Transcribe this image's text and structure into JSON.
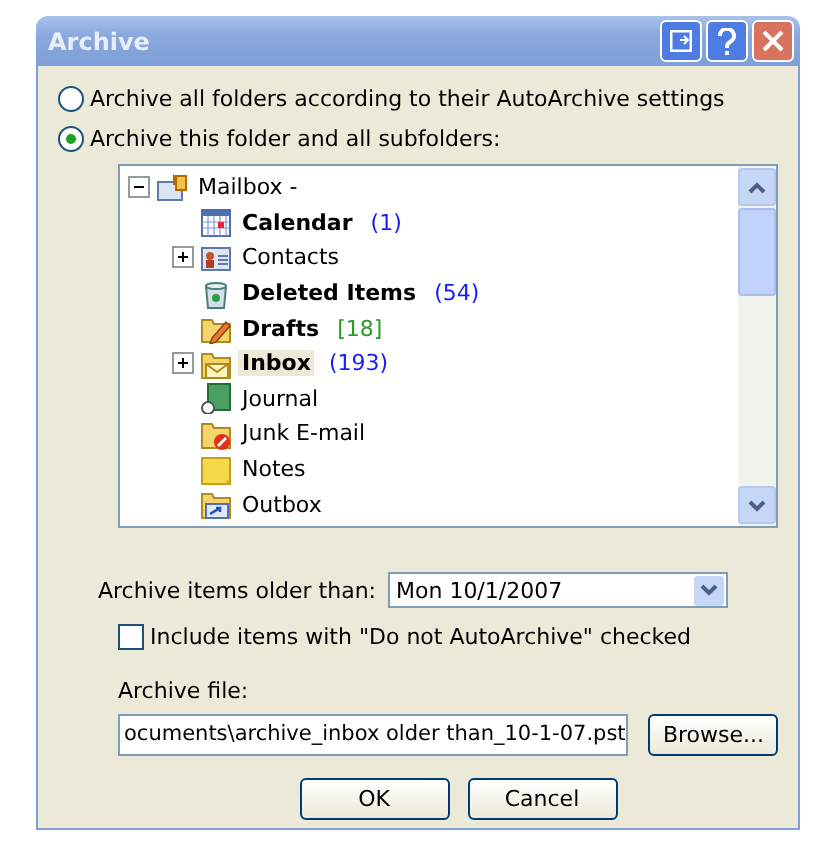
{
  "window": {
    "title": "Archive"
  },
  "scope_options": [
    {
      "label": "Archive all folders according to their AutoArchive settings",
      "selected": false
    },
    {
      "label": "Archive this folder and all subfolders:",
      "selected": true
    }
  ],
  "folder_tree": {
    "items": [
      {
        "name": "Mailbox -",
        "kind": "mailbox",
        "bold": false,
        "expanded": true,
        "selected": false,
        "children": [
          {
            "name": "Calendar",
            "kind": "calendar",
            "count": "(1)",
            "color": "#1a1aff",
            "bold": true,
            "selected": false
          },
          {
            "name": "Contacts",
            "kind": "contacts",
            "bold": false,
            "expanded": false,
            "selected": false
          },
          {
            "name": "Deleted Items",
            "kind": "trash",
            "count": "(54)",
            "color": "#1a1aff",
            "bold": true,
            "selected": false
          },
          {
            "name": "Drafts",
            "kind": "drafts",
            "count": "[18]",
            "color": "#2a9a2a",
            "bold": true,
            "selected": false
          },
          {
            "name": "Inbox",
            "kind": "inbox",
            "count": "(193)",
            "color": "#1a1aff",
            "bold": true,
            "expanded": false,
            "selected": true
          },
          {
            "name": "Journal",
            "kind": "journal",
            "bold": false,
            "selected": false
          },
          {
            "name": "Junk E-mail",
            "kind": "junk",
            "bold": false,
            "selected": false
          },
          {
            "name": "Notes",
            "kind": "notes",
            "bold": false,
            "selected": false
          },
          {
            "name": "Outbox",
            "kind": "outbox",
            "bold": false,
            "selected": false
          }
        ]
      }
    ]
  },
  "older_than": {
    "label": "Archive items older than:",
    "value": "Mon 10/1/2007"
  },
  "include_do_not_archive": {
    "label": "Include items with \"Do not AutoArchive\" checked",
    "checked": false
  },
  "archive_file": {
    "label": "Archive file:",
    "value": "ocuments\\archive_inbox older than_10-1-07.pst",
    "browse": "Browse..."
  },
  "buttons": [
    "OK",
    "Cancel"
  ]
}
